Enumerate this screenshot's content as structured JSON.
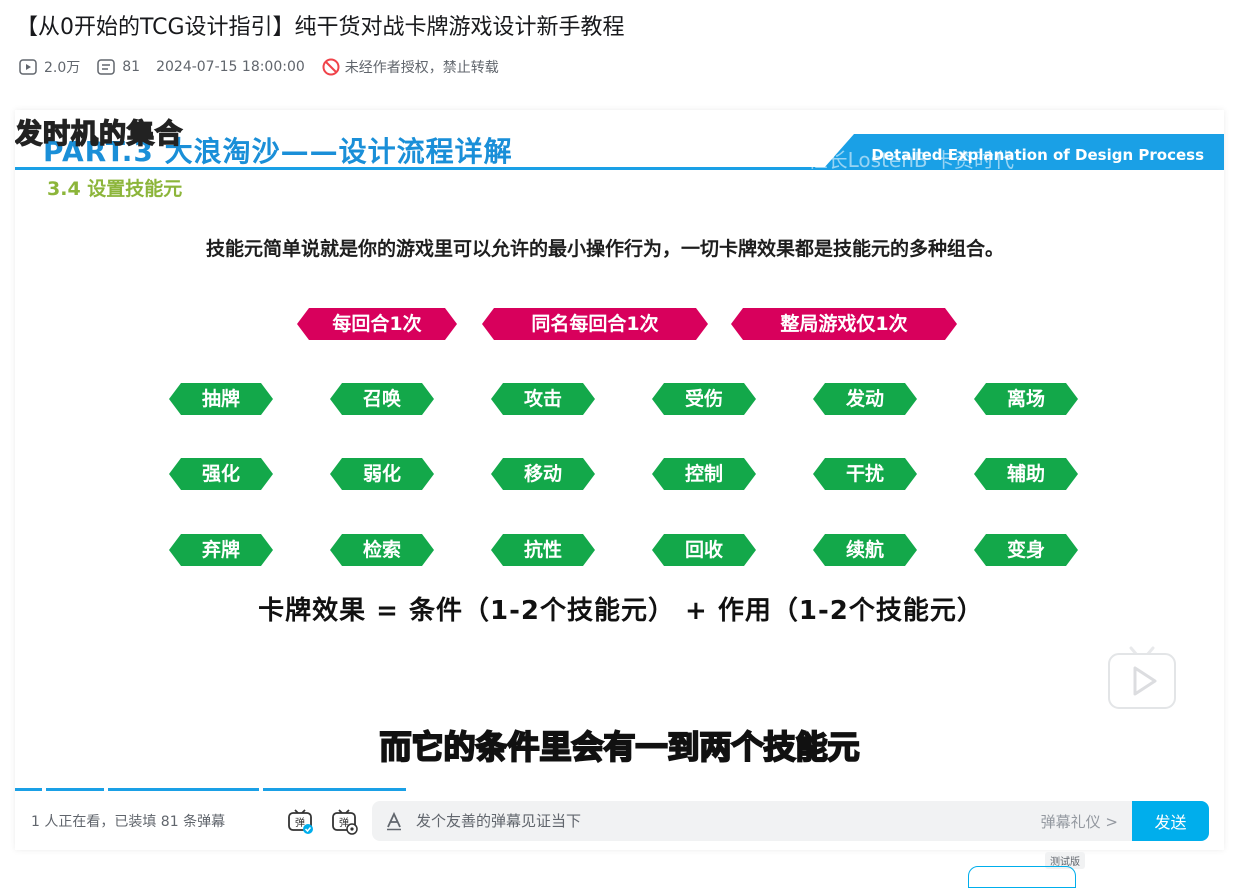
{
  "video": {
    "title": "【从0开始的TCG设计指引】纯干货对战卡牌游戏设计新手教程",
    "views": "2.0万",
    "danmaku_count": "81",
    "publish_time": "2024-07-15 18:00:00",
    "copyright_notice": "未经作者授权，禁止转载"
  },
  "slide": {
    "uploader_watermark": "发时机的集合",
    "part_title": "PART.3 大浪淘沙——设计流程详解",
    "header_en": "Detailed Explanation of Design Process",
    "header_watermark": "社长LostenB 卡资时代",
    "sub_heading": "3.4 设置技能元",
    "intro": "技能元简单说就是你的游戏里可以允许的最小操作行为，一切卡牌效果都是技能元的多种组合。",
    "limit_tags": [
      "每回合1次",
      "同名每回合1次",
      "整局游戏仅1次"
    ],
    "skill_rows": [
      [
        "抽牌",
        "召唤",
        "攻击",
        "受伤",
        "发动",
        "离场"
      ],
      [
        "强化",
        "弱化",
        "移动",
        "控制",
        "干扰",
        "辅助"
      ],
      [
        "弃牌",
        "检索",
        "抗性",
        "回收",
        "续航",
        "变身"
      ]
    ],
    "formula": "卡牌效果 = 条件（1-2个技能元） + 作用（1-2个技能元）",
    "subtitle": "而它的条件里会有一到两个技能元"
  },
  "colors": {
    "accent_blue": "#1aa0e6",
    "tag_red": "#d8005c",
    "tag_green": "#13a84a",
    "heading_green": "#8cb53a",
    "send_blue": "#00aeec"
  },
  "controls": {
    "viewers_text": "1 人正在看，已装填 81 条弹幕",
    "danmaku_toggle_icon": "danmaku-toggle-icon",
    "danmaku_settings_icon": "danmaku-settings-icon",
    "input_placeholder": "发个友善的弹幕见证当下",
    "etiquette_label": "弹幕礼仪 >",
    "send_label": "发送",
    "test_badge": "测试版"
  }
}
